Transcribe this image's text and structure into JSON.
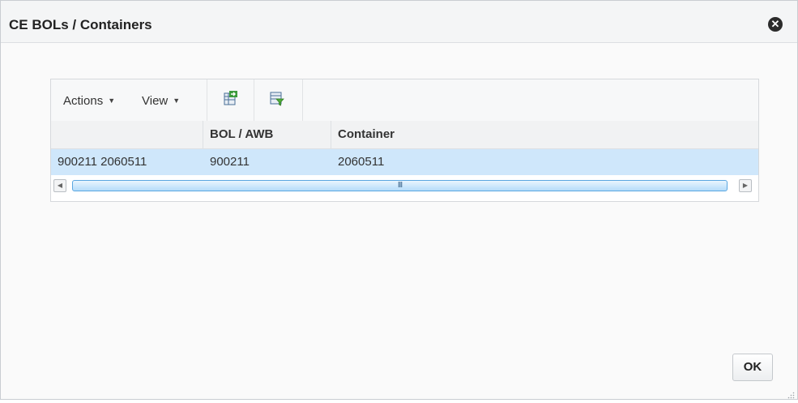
{
  "dialog": {
    "title": "CE BOLs / Containers",
    "close_icon": "close-circle-icon",
    "ok_label": "OK"
  },
  "toolbar": {
    "actions_label": "Actions",
    "view_label": "View",
    "export_icon": "export-to-excel-icon",
    "filter_icon": "query-by-example-icon"
  },
  "table": {
    "columns": [
      "",
      "BOL / AWB",
      "Container"
    ],
    "rows": [
      {
        "label": "900211 2060511",
        "bol_awb": "900211",
        "container": "2060511"
      }
    ]
  },
  "scrollbar": {
    "grip": "III"
  },
  "colors": {
    "selected_row": "#cfe7fb",
    "scroll_thumb_border": "#5aa6e0"
  }
}
